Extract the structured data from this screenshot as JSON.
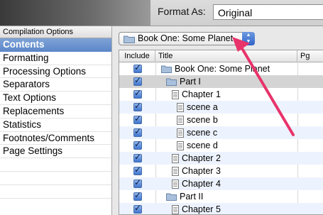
{
  "toolbar": {
    "format_label": "Format As:",
    "format_value": "Original"
  },
  "sidebar": {
    "header": "Compilation Options",
    "items": [
      "Contents",
      "Formatting",
      "Processing Options",
      "Separators",
      "Text Options",
      "Replacements",
      "Statistics",
      "Footnotes/Comments",
      "Page Settings"
    ],
    "selected_index": 0
  },
  "popup": {
    "label": "Book One: Some Planet"
  },
  "table": {
    "columns": [
      "Include",
      "Title",
      "Pg"
    ],
    "rows": [
      {
        "title": "Book One: Some Planet",
        "type": "folder",
        "level": 0,
        "included": true
      },
      {
        "title": "Part I",
        "type": "folder",
        "level": 1,
        "included": true
      },
      {
        "title": "Chapter 1",
        "type": "doc",
        "level": 2,
        "included": true
      },
      {
        "title": "scene a",
        "type": "doc",
        "level": 3,
        "included": true
      },
      {
        "title": "scene b",
        "type": "doc",
        "level": 3,
        "included": true
      },
      {
        "title": "scene c",
        "type": "doc",
        "level": 3,
        "included": true
      },
      {
        "title": "scene d",
        "type": "doc",
        "level": 3,
        "included": true
      },
      {
        "title": "Chapter 2",
        "type": "doc",
        "level": 2,
        "included": true
      },
      {
        "title": "Chapter 3",
        "type": "doc",
        "level": 2,
        "included": true
      },
      {
        "title": "Chapter 4",
        "type": "doc",
        "level": 2,
        "included": true
      },
      {
        "title": "Part II",
        "type": "folder",
        "level": 1,
        "included": true
      },
      {
        "title": "Chapter 5",
        "type": "doc",
        "level": 2,
        "included": true
      }
    ]
  },
  "annotation": {
    "color": "#e8336b"
  }
}
